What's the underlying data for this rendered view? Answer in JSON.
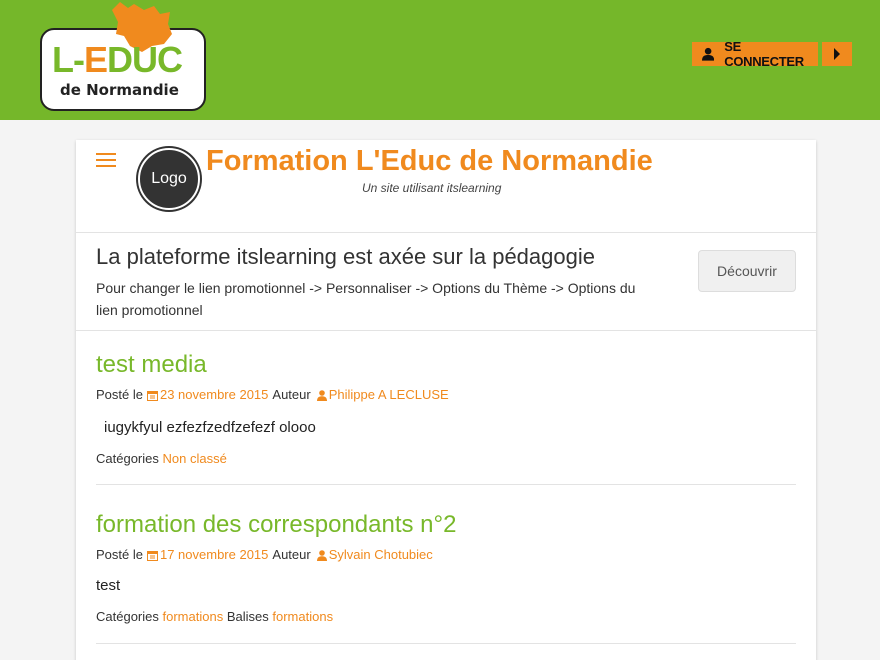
{
  "header": {
    "logo_main_prefix": "L-",
    "logo_main_e": "E",
    "logo_main_suffix": "DUC",
    "logo_sub": "de Normandie",
    "connect_label": "SE CONNECTER",
    "colors": {
      "green": "#75b72a",
      "orange": "#f08a1e"
    }
  },
  "site": {
    "logo_label": "Logo",
    "title": "Formation L'Educ de Normandie",
    "tagline": "Un site utilisant itslearning"
  },
  "promo": {
    "title": "La plateforme itslearning est axée sur la pédagogie",
    "text": "Pour changer le lien promotionnel -> Personnaliser -> Options du Thème -> Options du lien promotionnel",
    "button_label": "Découvrir"
  },
  "posts": [
    {
      "title": "test media",
      "posted_label": "Posté le",
      "date": "23 novembre 2015",
      "author_label": "Auteur",
      "author": "Philippe A LECLUSE",
      "excerpt": "iugykfyul ezfezfzedfzefezf olooo",
      "categories_label": "Catégories",
      "category": "Non classé"
    },
    {
      "title": "formation des correspondants n°2",
      "posted_label": "Posté le",
      "date": "17 novembre 2015",
      "author_label": "Auteur",
      "author": "Sylvain Chotubiec",
      "excerpt": "test",
      "categories_label": "Catégories",
      "category": "formations",
      "tags_label": "Balises",
      "tag": "formations"
    }
  ],
  "icons": {
    "menu": "hamburger-icon",
    "user": "user-icon",
    "arrow": "caret-right-icon",
    "calendar": "calendar-icon",
    "author": "author-icon"
  }
}
